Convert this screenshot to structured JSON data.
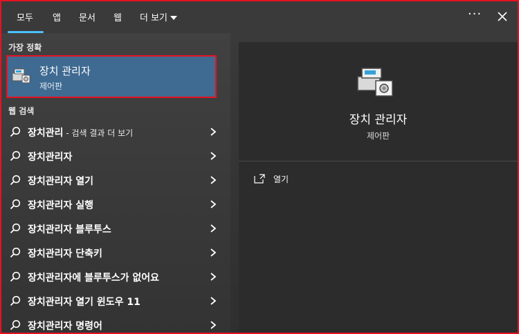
{
  "tabs": [
    {
      "label": "모두",
      "selected": true
    },
    {
      "label": "앱"
    },
    {
      "label": "문서"
    },
    {
      "label": "웹"
    },
    {
      "label": "더 보기"
    }
  ],
  "header": {
    "more_options_label": "···"
  },
  "colors": {
    "accent": "#4cc2ff",
    "highlight_border": "#e81123",
    "selected_bg": "#3f6a91"
  },
  "best_match": {
    "section_label": "가장 정확",
    "title": "장치 관리자",
    "subtitle": "제어판",
    "icon": "device-manager-icon"
  },
  "web_search": {
    "section_label": "웹 검색",
    "items": [
      {
        "text": "장치관리",
        "suffix": " - 검색 결과 더 보기"
      },
      {
        "text": "장치관리자",
        "suffix": ""
      },
      {
        "text": "장치관리자 열기",
        "suffix": ""
      },
      {
        "text": "장치관리자 실행",
        "suffix": ""
      },
      {
        "text": "장치관리자 블루투스",
        "suffix": ""
      },
      {
        "text": "장치관리자 단축키",
        "suffix": ""
      },
      {
        "text": "장치관리자에 블루투스가 없어요",
        "suffix": ""
      },
      {
        "text": "장치관리자 열기 윈도우 11",
        "suffix": ""
      },
      {
        "text": "장치관리자 명령어",
        "suffix": ""
      }
    ]
  },
  "detail": {
    "title": "장치 관리자",
    "subtitle": "제어판",
    "actions": [
      {
        "label": "열기",
        "icon": "open-icon"
      }
    ]
  }
}
